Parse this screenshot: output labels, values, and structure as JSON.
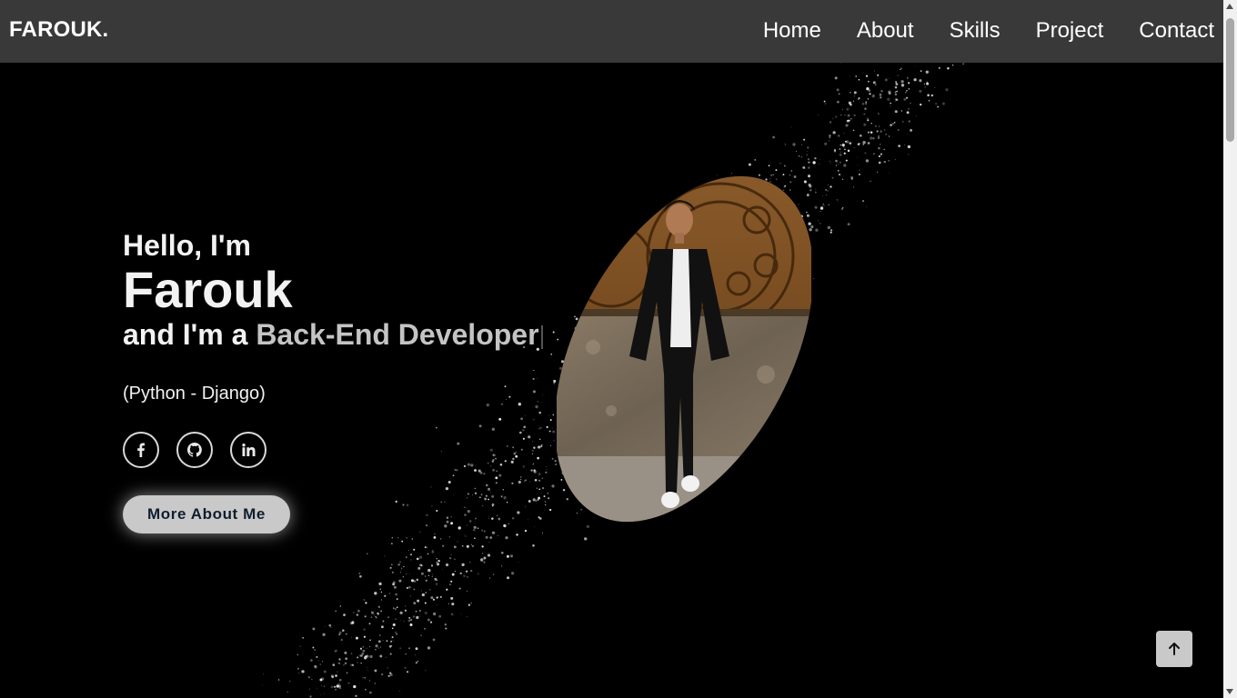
{
  "nav": {
    "brand": "FAROUK.",
    "links": [
      "Home",
      "About",
      "Skills",
      "Project",
      "Contact"
    ]
  },
  "hero": {
    "greeting": "Hello, I'm",
    "name": "Farouk",
    "role_prefix": "and I'm a ",
    "role": "Back-End Developer",
    "stack": "(Python - Django)",
    "cta": "More About Me"
  },
  "socials": [
    "facebook-icon",
    "github-icon",
    "linkedin-icon"
  ],
  "colors": {
    "navbar": "#393939",
    "background": "#000000",
    "button": "#c9c9c9",
    "button_text": "#0f1e2e"
  }
}
